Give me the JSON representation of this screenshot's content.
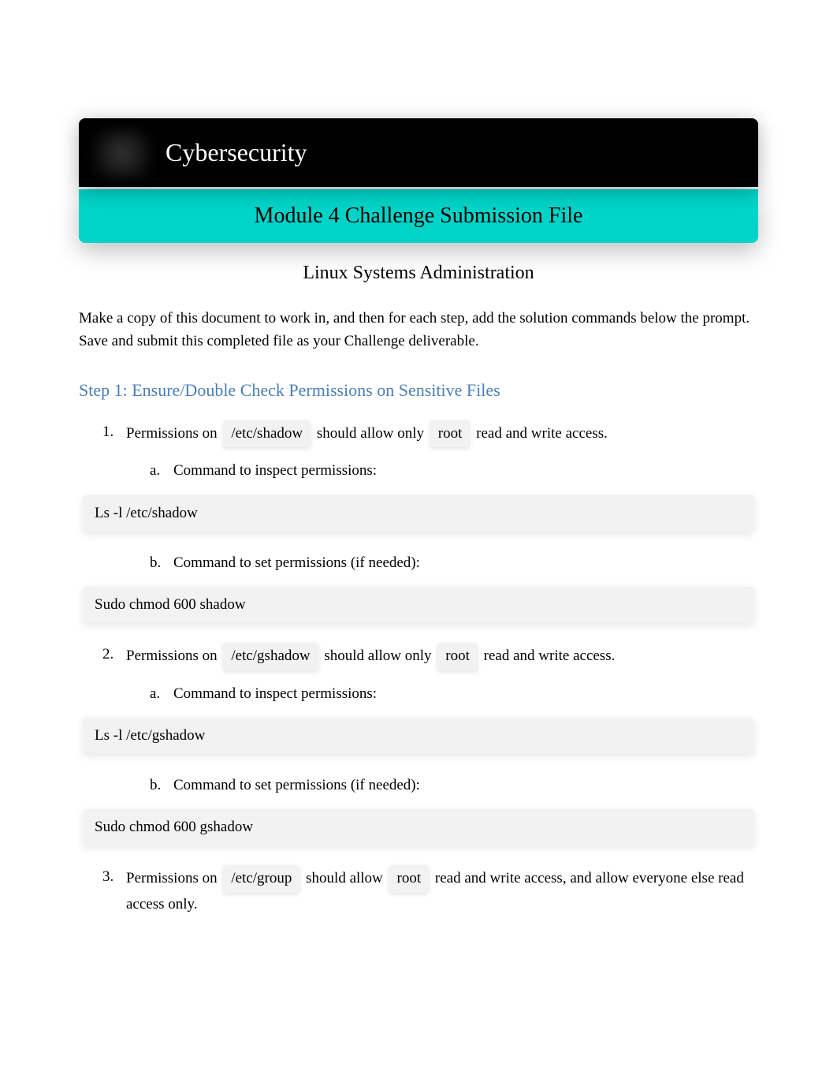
{
  "header": {
    "title": "Cybersecurity",
    "subtitle_bar": "Module 4 Challenge Submission File",
    "subtitle": "Linux Systems Administration"
  },
  "intro": "Make a copy of this document to work in, and then for each step, add the solution commands below the prompt. Save and submit this completed file as your Challenge deliverable.",
  "step1": {
    "heading": "Step 1: Ensure/Double Check Permissions on Sensitive Files",
    "items": [
      {
        "num": "1.",
        "pre": "Permissions on ",
        "path": "/etc/shadow",
        "mid": " should allow only ",
        "user": "root",
        "post": " read and write access.",
        "sub": [
          {
            "letter": "a.",
            "text": "Command to inspect permissions:",
            "answer": "Ls -l /etc/shadow"
          },
          {
            "letter": "b.",
            "text": "Command to set permissions (if needed):",
            "answer": "Sudo chmod 600 shadow"
          }
        ]
      },
      {
        "num": "2.",
        "pre": "Permissions on ",
        "path": "/etc/gshadow",
        "mid": " should allow only ",
        "user": "root",
        "post": " read and write access.",
        "sub": [
          {
            "letter": "a.",
            "text": "Command to inspect permissions:",
            "answer": "Ls -l /etc/gshadow"
          },
          {
            "letter": "b.",
            "text": "Command to set permissions (if needed):",
            "answer": "Sudo chmod 600 gshadow"
          }
        ]
      },
      {
        "num": "3.",
        "pre": "Permissions on ",
        "path": "/etc/group",
        "mid": " should allow ",
        "user": "root",
        "post": " read and write access, and allow everyone else read access only.",
        "sub": []
      }
    ]
  }
}
